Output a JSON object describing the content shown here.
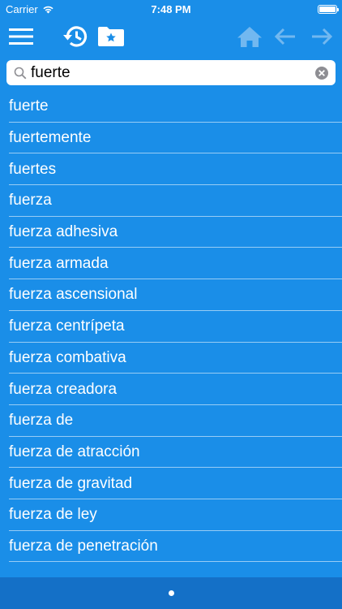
{
  "status": {
    "carrier": "Carrier",
    "time": "7:48 PM"
  },
  "search": {
    "value": "fuerte"
  },
  "list": {
    "items": [
      "fuerte",
      "fuertemente",
      "fuertes",
      "fuerza",
      "fuerza adhesiva",
      "fuerza armada",
      "fuerza ascensional",
      "fuerza centrípeta",
      "fuerza combativa",
      "fuerza creadora",
      "fuerza de",
      "fuerza de atracción",
      "fuerza de gravitad",
      "fuerza de ley",
      "fuerza de penetración"
    ]
  },
  "colors": {
    "background": "#1a8ee8",
    "bottom_bar": "#1470c7",
    "inactive_icon": "#72b8f0"
  },
  "icons": {
    "menu": "hamburger-icon",
    "history": "history-icon",
    "favorites": "folder-star-icon",
    "home": "home-icon",
    "back": "arrow-left-icon",
    "forward": "arrow-right-icon",
    "search": "search-icon",
    "clear": "clear-icon"
  }
}
